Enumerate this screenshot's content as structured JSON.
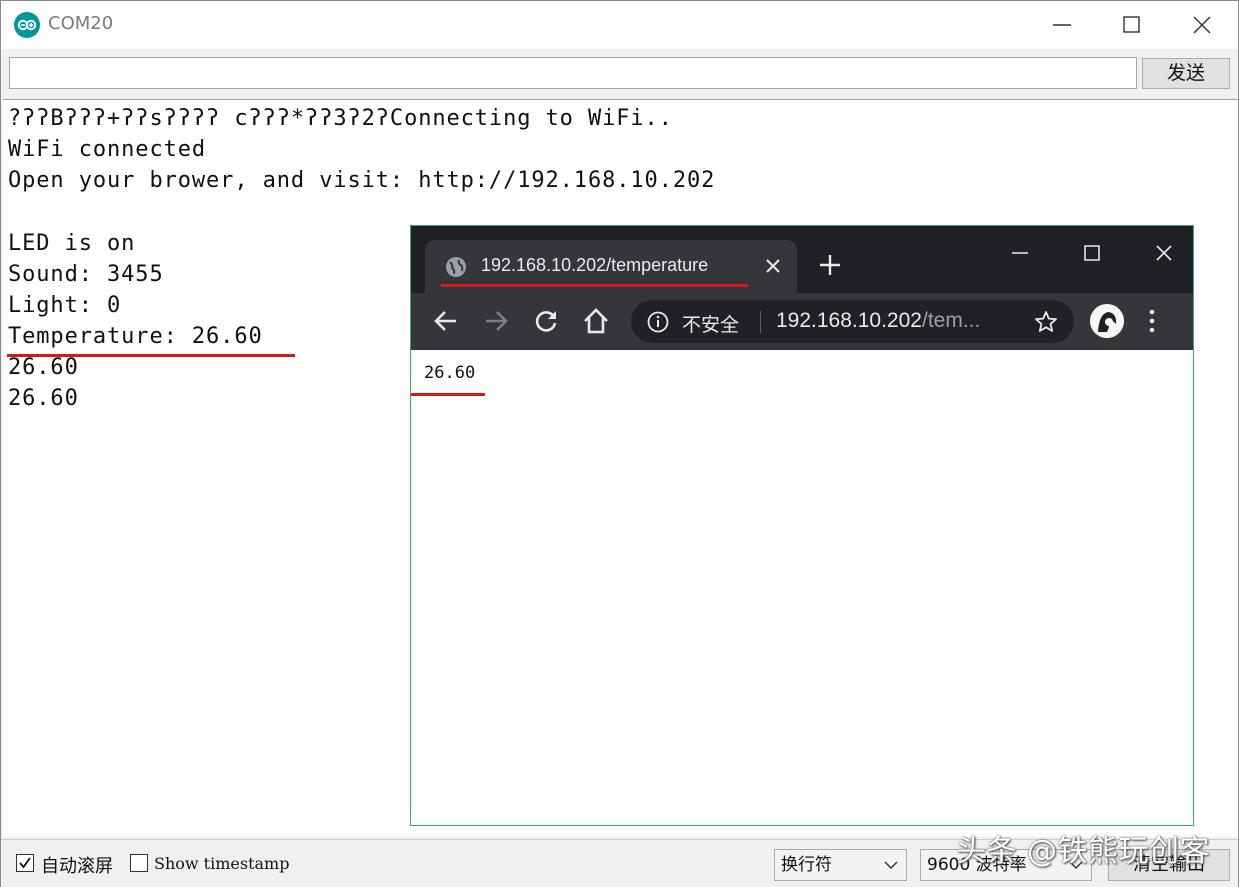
{
  "window": {
    "title": "COM20",
    "send_button": "发送",
    "send_input_value": ""
  },
  "console": {
    "lines": [
      "?\u0000\u0000B\u0000\u0000\u0000+\u0000\u0000s\u0000\u0000\u0000\u0000 c\u0000\u0000\u0000*\u0000\u00003\u00002\u0000Connecting to WiFi..",
      "WiFi connected",
      "Open your brower, and visit: http://192.168.10.202",
      "",
      "LED is on",
      "Sound: 3455",
      "Light: 0",
      "Temperature: 26.60",
      "26.60",
      "26.60"
    ]
  },
  "status_bar": {
    "autoscroll_label": "自动滚屏",
    "autoscroll_checked": true,
    "timestamp_label": "Show timestamp",
    "timestamp_checked": false,
    "line_ending": "换行符",
    "baud_rate": "9600 波特率",
    "clear_button": "清空输出"
  },
  "browser": {
    "tab_title": "192.168.10.202/temperature",
    "security_label": "不安全",
    "url_host": "192.168.10.202",
    "url_path": "/tem...",
    "page_text": "26.60"
  },
  "watermark": "头条 @铁熊玩创客",
  "colors": {
    "arduino_teal": "#00979c",
    "annotation_red": "#d7191f",
    "chrome_dark": "#202124",
    "chrome_toolbar": "#35363a",
    "chrome_border": "#3aa776"
  }
}
